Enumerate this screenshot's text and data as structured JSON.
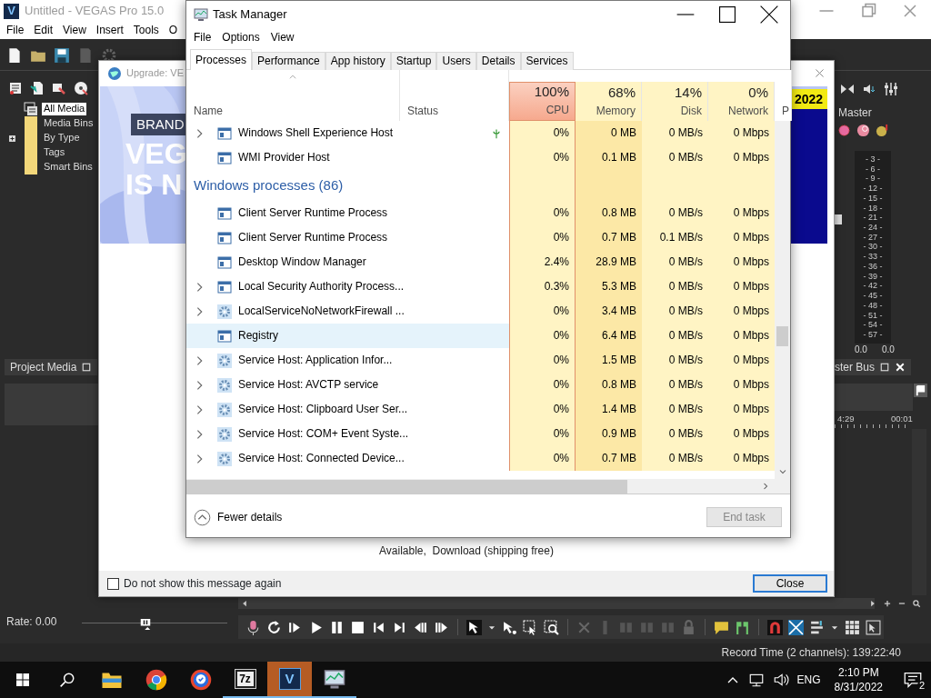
{
  "vegas": {
    "logo": "V",
    "title": "Untitled - VEGAS Pro 15.0",
    "menu": [
      "File",
      "Edit",
      "View",
      "Insert",
      "Tools",
      "O"
    ],
    "media_tree": [
      {
        "kind": "stack",
        "label": "All Media",
        "selected": true,
        "expandable": false
      },
      {
        "kind": "folder",
        "label": "Media Bins",
        "selected": false,
        "expandable": false
      },
      {
        "kind": "folder",
        "label": "By Type",
        "selected": false,
        "expandable": true
      },
      {
        "kind": "folder",
        "label": "Tags",
        "selected": false,
        "expandable": false
      },
      {
        "kind": "folder",
        "label": "Smart Bins",
        "selected": false,
        "expandable": false
      }
    ],
    "project_media_tab": "Project Media",
    "mixer": {
      "label": "Master",
      "scale": [
        "- 3 -",
        "- 6 -",
        "- 9 -",
        "- 12 -",
        "- 15 -",
        "- 18 -",
        "- 21 -",
        "- 24 -",
        "- 27 -",
        "- 30 -",
        "- 33 -",
        "- 36 -",
        "- 39 -",
        "- 42 -",
        "- 45 -",
        "- 48 -",
        "- 51 -",
        "- 54 -",
        "- 57 -"
      ],
      "readings": [
        "0.0",
        "0.0"
      ],
      "tab": "ster Bus"
    },
    "ruler": [
      "4:29",
      "00:01"
    ],
    "rate": {
      "label": "Rate: 0.00",
      "level": 0.44
    },
    "status": "Record Time (2 channels): 139:22:40"
  },
  "upgrade_dialog": {
    "title": "Upgrade: VE",
    "banner": {
      "tag": "BRAND",
      "headline": [
        "VEG",
        "IS N"
      ],
      "badge": "2022"
    },
    "text": "Available,  Download (shipping free)",
    "checkbox": {
      "label": "Do not show this message again",
      "checked": false
    },
    "button": "Close"
  },
  "task_manager": {
    "title": "Task Manager",
    "menu": [
      "File",
      "Options",
      "View"
    ],
    "tabs": [
      {
        "label": "Processes",
        "selected": true
      },
      {
        "label": "Performance",
        "selected": false
      },
      {
        "label": "App history",
        "selected": false
      },
      {
        "label": "Startup",
        "selected": false
      },
      {
        "label": "Users",
        "selected": false
      },
      {
        "label": "Details",
        "selected": false
      },
      {
        "label": "Services",
        "selected": false
      }
    ],
    "columns": [
      {
        "name": "Name",
        "sorted": true,
        "selected": false
      },
      {
        "name": "Status",
        "sorted": false,
        "selected": false
      },
      {
        "usage": "100%",
        "name": "CPU",
        "sorted": false,
        "selected": true
      },
      {
        "usage": "68%",
        "name": "Memory",
        "sorted": false,
        "selected": false
      },
      {
        "usage": "14%",
        "name": "Disk",
        "sorted": false,
        "selected": false
      },
      {
        "usage": "0%",
        "name": "Network",
        "sorted": false,
        "selected": false
      },
      {
        "name": "P",
        "sorted": false,
        "selected": false
      }
    ],
    "rows": [
      {
        "kind": "app",
        "name": "Windows Shell Experience Host",
        "expandable": true,
        "suspended": true,
        "selected": false,
        "values": [
          "0%",
          "0 MB",
          "0 MB/s",
          "0 Mbps"
        ]
      },
      {
        "kind": "app",
        "name": "WMI Provider Host",
        "expandable": false,
        "suspended": false,
        "selected": false,
        "values": [
          "0%",
          "0.1 MB",
          "0 MB/s",
          "0 Mbps"
        ]
      },
      {
        "kind": "group",
        "name": "Windows processes (86)"
      },
      {
        "kind": "app",
        "name": "Client Server Runtime Process",
        "expandable": false,
        "suspended": false,
        "selected": false,
        "values": [
          "0%",
          "0.8 MB",
          "0 MB/s",
          "0 Mbps"
        ]
      },
      {
        "kind": "app",
        "name": "Client Server Runtime Process",
        "expandable": false,
        "suspended": false,
        "selected": false,
        "values": [
          "0%",
          "0.7 MB",
          "0.1 MB/s",
          "0 Mbps"
        ]
      },
      {
        "kind": "app",
        "name": "Desktop Window Manager",
        "expandable": false,
        "suspended": false,
        "selected": false,
        "values": [
          "2.4%",
          "28.9 MB",
          "0 MB/s",
          "0 Mbps"
        ]
      },
      {
        "kind": "app",
        "name": "Local Security Authority Process...",
        "expandable": true,
        "suspended": false,
        "selected": false,
        "values": [
          "0.3%",
          "5.3 MB",
          "0 MB/s",
          "0 Mbps"
        ]
      },
      {
        "kind": "service",
        "name": "LocalServiceNoNetworkFirewall ...",
        "expandable": true,
        "suspended": false,
        "selected": false,
        "values": [
          "0%",
          "3.4 MB",
          "0 MB/s",
          "0 Mbps"
        ]
      },
      {
        "kind": "app",
        "name": "Registry",
        "expandable": false,
        "suspended": false,
        "selected": true,
        "values": [
          "0%",
          "6.4 MB",
          "0 MB/s",
          "0 Mbps"
        ]
      },
      {
        "kind": "service",
        "name": "Service Host: Application Infor...",
        "expandable": true,
        "suspended": false,
        "selected": false,
        "values": [
          "0%",
          "1.5 MB",
          "0 MB/s",
          "0 Mbps"
        ]
      },
      {
        "kind": "service",
        "name": "Service Host: AVCTP service",
        "expandable": true,
        "suspended": false,
        "selected": false,
        "values": [
          "0%",
          "0.8 MB",
          "0 MB/s",
          "0 Mbps"
        ]
      },
      {
        "kind": "service",
        "name": "Service Host: Clipboard User Ser...",
        "expandable": true,
        "suspended": false,
        "selected": false,
        "values": [
          "0%",
          "1.4 MB",
          "0 MB/s",
          "0 Mbps"
        ]
      },
      {
        "kind": "service",
        "name": "Service Host: COM+ Event Syste...",
        "expandable": true,
        "suspended": false,
        "selected": false,
        "values": [
          "0%",
          "0.9 MB",
          "0 MB/s",
          "0 Mbps"
        ]
      },
      {
        "kind": "service",
        "name": "Service Host: Connected Device...",
        "expandable": true,
        "suspended": false,
        "selected": false,
        "values": [
          "0%",
          "0.7 MB",
          "0 MB/s",
          "0 Mbps"
        ]
      }
    ],
    "fewer_details": "Fewer details",
    "end_task": {
      "label": "End task",
      "disabled": true
    }
  },
  "taskbar": {
    "apps": [
      {
        "kind": "start"
      },
      {
        "kind": "search"
      },
      {
        "kind": "explorer",
        "running": false,
        "selected": false
      },
      {
        "kind": "chrome",
        "running": false,
        "selected": false
      },
      {
        "kind": "browser",
        "running": false,
        "selected": false
      },
      {
        "kind": "archiver",
        "glyph": "7z",
        "running": true,
        "selected": false
      },
      {
        "kind": "vegas",
        "glyph": "V",
        "running": true,
        "selected": true
      },
      {
        "kind": "taskmgr",
        "running": true,
        "selected": false
      }
    ],
    "language": "ENG",
    "time": "2:10 PM",
    "date": "8/31/2022",
    "notifications": "2"
  }
}
